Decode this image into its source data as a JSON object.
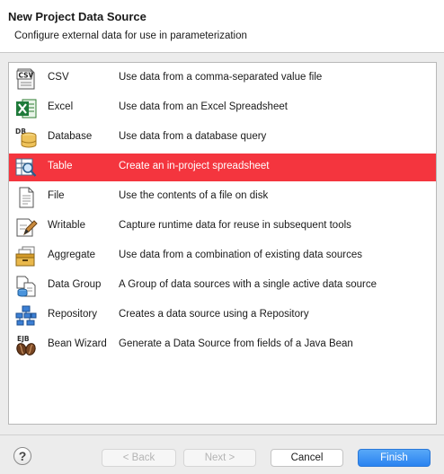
{
  "dialog": {
    "title": "New Project Data Source",
    "subtitle": "Configure external data for use in parameterization"
  },
  "sources": [
    {
      "name": "CSV",
      "description": "Use data from a comma-separated value file",
      "icon": "csv-file-icon"
    },
    {
      "name": "Excel",
      "description": "Use data from an Excel Spreadsheet",
      "icon": "excel-icon"
    },
    {
      "name": "Database",
      "description": "Use data from a database query",
      "icon": "database-icon"
    },
    {
      "name": "Table",
      "description": "Create an in-project spreadsheet",
      "icon": "table-icon",
      "selected": true
    },
    {
      "name": "File",
      "description": "Use the contents of a file on disk",
      "icon": "file-icon"
    },
    {
      "name": "Writable",
      "description": "Capture runtime data for reuse in subsequent tools",
      "icon": "writable-icon"
    },
    {
      "name": "Aggregate",
      "description": "Use data from a combination of existing data sources",
      "icon": "aggregate-icon"
    },
    {
      "name": "Data Group",
      "description": "A Group of data sources with a single active data source",
      "icon": "data-group-icon"
    },
    {
      "name": "Repository",
      "description": "Creates a data source using a Repository",
      "icon": "repository-icon"
    },
    {
      "name": "Bean Wizard",
      "description": "Generate a Data Source from fields of a Java Bean",
      "icon": "java-bean-icon"
    }
  ],
  "buttons": {
    "help": "?",
    "back": "< Back",
    "next": "Next >",
    "cancel": "Cancel",
    "finish": "Finish"
  },
  "colors": {
    "selection": "#f4353e",
    "primary": "#2a83f0"
  }
}
